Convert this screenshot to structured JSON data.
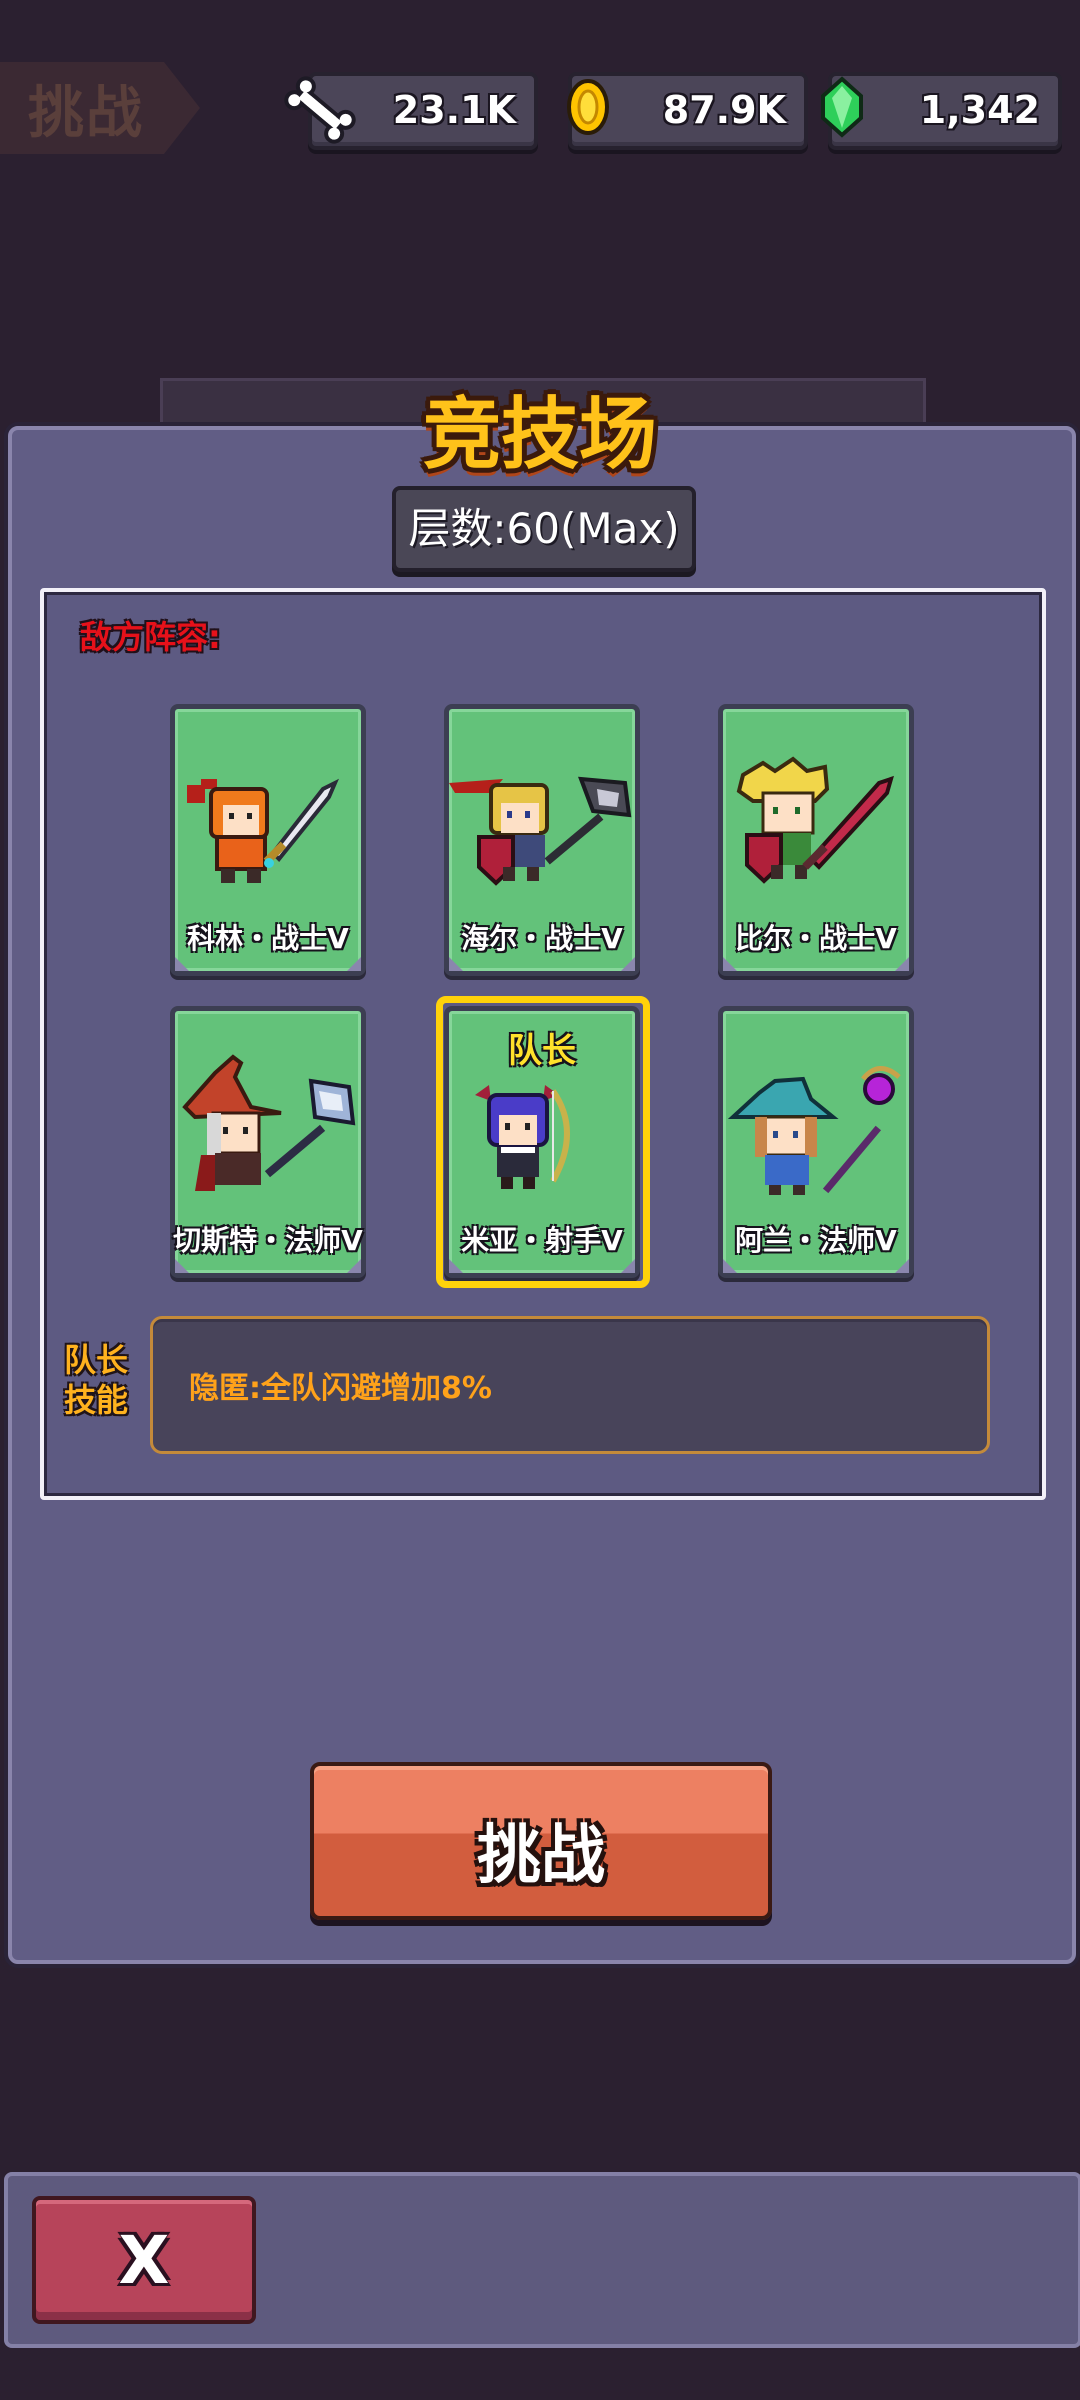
{
  "background": {
    "tag_label": "挑战"
  },
  "resources": [
    {
      "icon": "bone-icon",
      "value": "23.1K"
    },
    {
      "icon": "gold-coin-icon",
      "value": "87.9K"
    },
    {
      "icon": "green-gem-icon",
      "value": "1,342"
    }
  ],
  "panel": {
    "title": "竞技场",
    "floor_label": "层数:60(Max)",
    "lineup_label": "敌方阵容:",
    "heroes": [
      {
        "name": "科林・战士V",
        "sprite": "warrior-orange-helmet-sword",
        "captain": false
      },
      {
        "name": "海尔・战士V",
        "sprite": "warrior-blonde-shield-axe",
        "captain": false
      },
      {
        "name": "比尔・战士V",
        "sprite": "warrior-blonde-shield-red-sword",
        "captain": false
      },
      {
        "name": "切斯特・法师V",
        "sprite": "mage-red-hat-hammer",
        "captain": false
      },
      {
        "name": "米亚・射手V",
        "sprite": "archer-purple-hair-bow",
        "captain": true
      },
      {
        "name": "阿兰・法师V",
        "sprite": "mage-teal-hat-staff",
        "captain": false
      }
    ],
    "captain_tag": "队长",
    "skill_label": "队长技能",
    "skill_text": "隐匿:全队闪避增加8%",
    "challenge_button": "挑战"
  },
  "close_button": "X",
  "colors": {
    "panel": "#615d85",
    "card": "#63c27a",
    "title": "#ffc21a",
    "captain_frame": "#ffd20a",
    "challenge": "#e56f50",
    "close": "#b7445a"
  }
}
